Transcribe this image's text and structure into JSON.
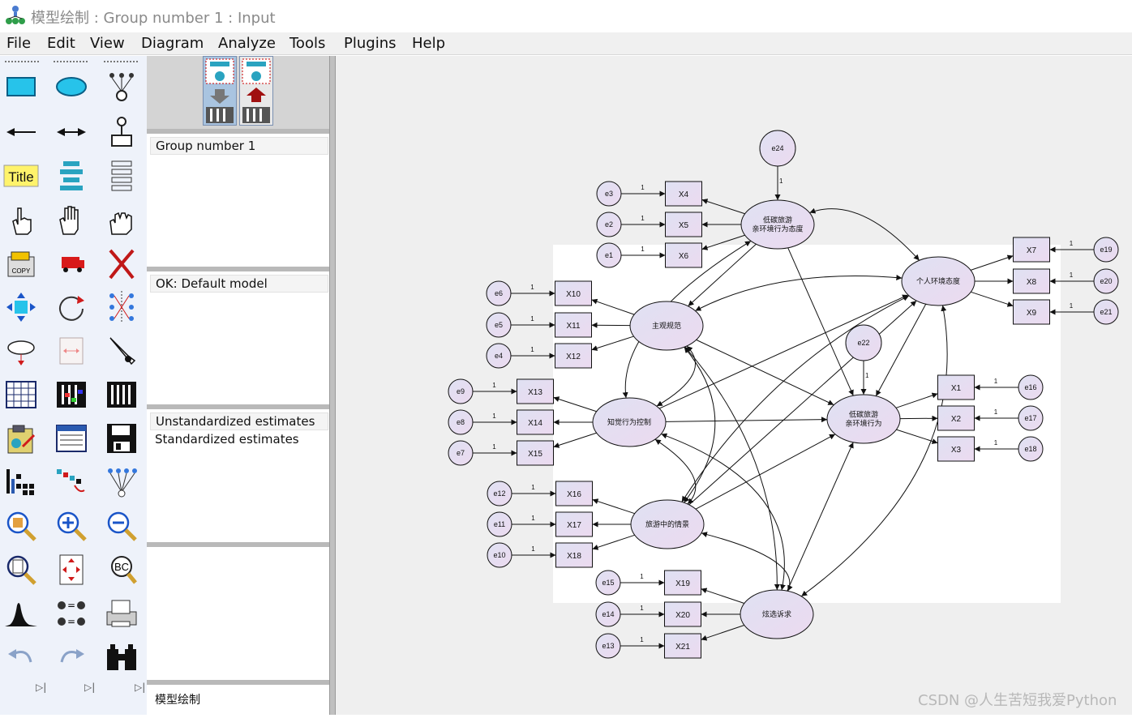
{
  "window": {
    "title": "模型绘制 : Group number 1 : Input"
  },
  "menu": [
    "File",
    "Edit",
    "View",
    "Diagram",
    "Analyze",
    "Tools",
    "Plugins",
    "Help"
  ],
  "toolbox": {
    "icons": [
      "rectangle-tool-icon",
      "ellipse-tool-icon",
      "indicator-tool-icon",
      "single-arrow-tool-icon",
      "double-arrow-tool-icon",
      "unique-variable-tool-icon",
      "title-tool-icon",
      "list-variables-icon",
      "list-data-variables-icon",
      "select-one-icon",
      "select-all-icon",
      "deselect-all-icon",
      "duplicate-icon",
      "move-icon",
      "erase-icon",
      "move-params-icon",
      "rotate-icon",
      "reflect-icon",
      "shape-change-icon",
      "scroll-icon",
      "touch-up-icon",
      "data-files-icon",
      "analysis-properties-icon",
      "calculate-estimates-icon",
      "view-text-icon",
      "view-output-icon",
      "save-icon",
      "object-properties-icon",
      "drag-properties-icon",
      "preserve-symmetries-icon",
      "zoom-area-icon",
      "zoom-in-icon",
      "zoom-out-icon",
      "zoom-page-icon",
      "fit-to-page-icon",
      "loupe-icon",
      "bayesian-icon",
      "multiple-group-icon",
      "print-icon",
      "undo-icon",
      "redo-icon",
      "specification-search-icon"
    ],
    "title_label": "Title"
  },
  "panel": {
    "groups_heading": "Group number 1",
    "models_heading": "OK: Default model",
    "estimates_heading": "Unstandardized estimates",
    "estimates_option": "Standardized estimates",
    "file_label": "模型绘制"
  },
  "diagram": {
    "latent": [
      {
        "id": "L1",
        "label": "低碳旅游\n亲环境行为态度"
      },
      {
        "id": "L2",
        "label": "个人环境态度"
      },
      {
        "id": "L3",
        "label": "主观规范"
      },
      {
        "id": "L4",
        "label": "知觉行为控制"
      },
      {
        "id": "L5",
        "label": "低碳旅游\n亲环境行为"
      },
      {
        "id": "L6",
        "label": "旅游中的情景"
      },
      {
        "id": "L7",
        "label": "炫选诉求"
      }
    ],
    "observed": [
      "X1",
      "X2",
      "X3",
      "X4",
      "X5",
      "X6",
      "X7",
      "X8",
      "X9",
      "X10",
      "X11",
      "X12",
      "X13",
      "X14",
      "X15",
      "X16",
      "X17",
      "X18",
      "X19",
      "X20",
      "X21"
    ],
    "errors": [
      "e1",
      "e2",
      "e3",
      "e4",
      "e5",
      "e6",
      "e7",
      "e8",
      "e9",
      "e10",
      "e11",
      "e12",
      "e13",
      "e14",
      "e15",
      "e16",
      "e17",
      "e18",
      "e19",
      "e20",
      "e21",
      "e22",
      "e24"
    ],
    "path_label": "1"
  },
  "watermark": "CSDN @人生苦短我爱Python"
}
